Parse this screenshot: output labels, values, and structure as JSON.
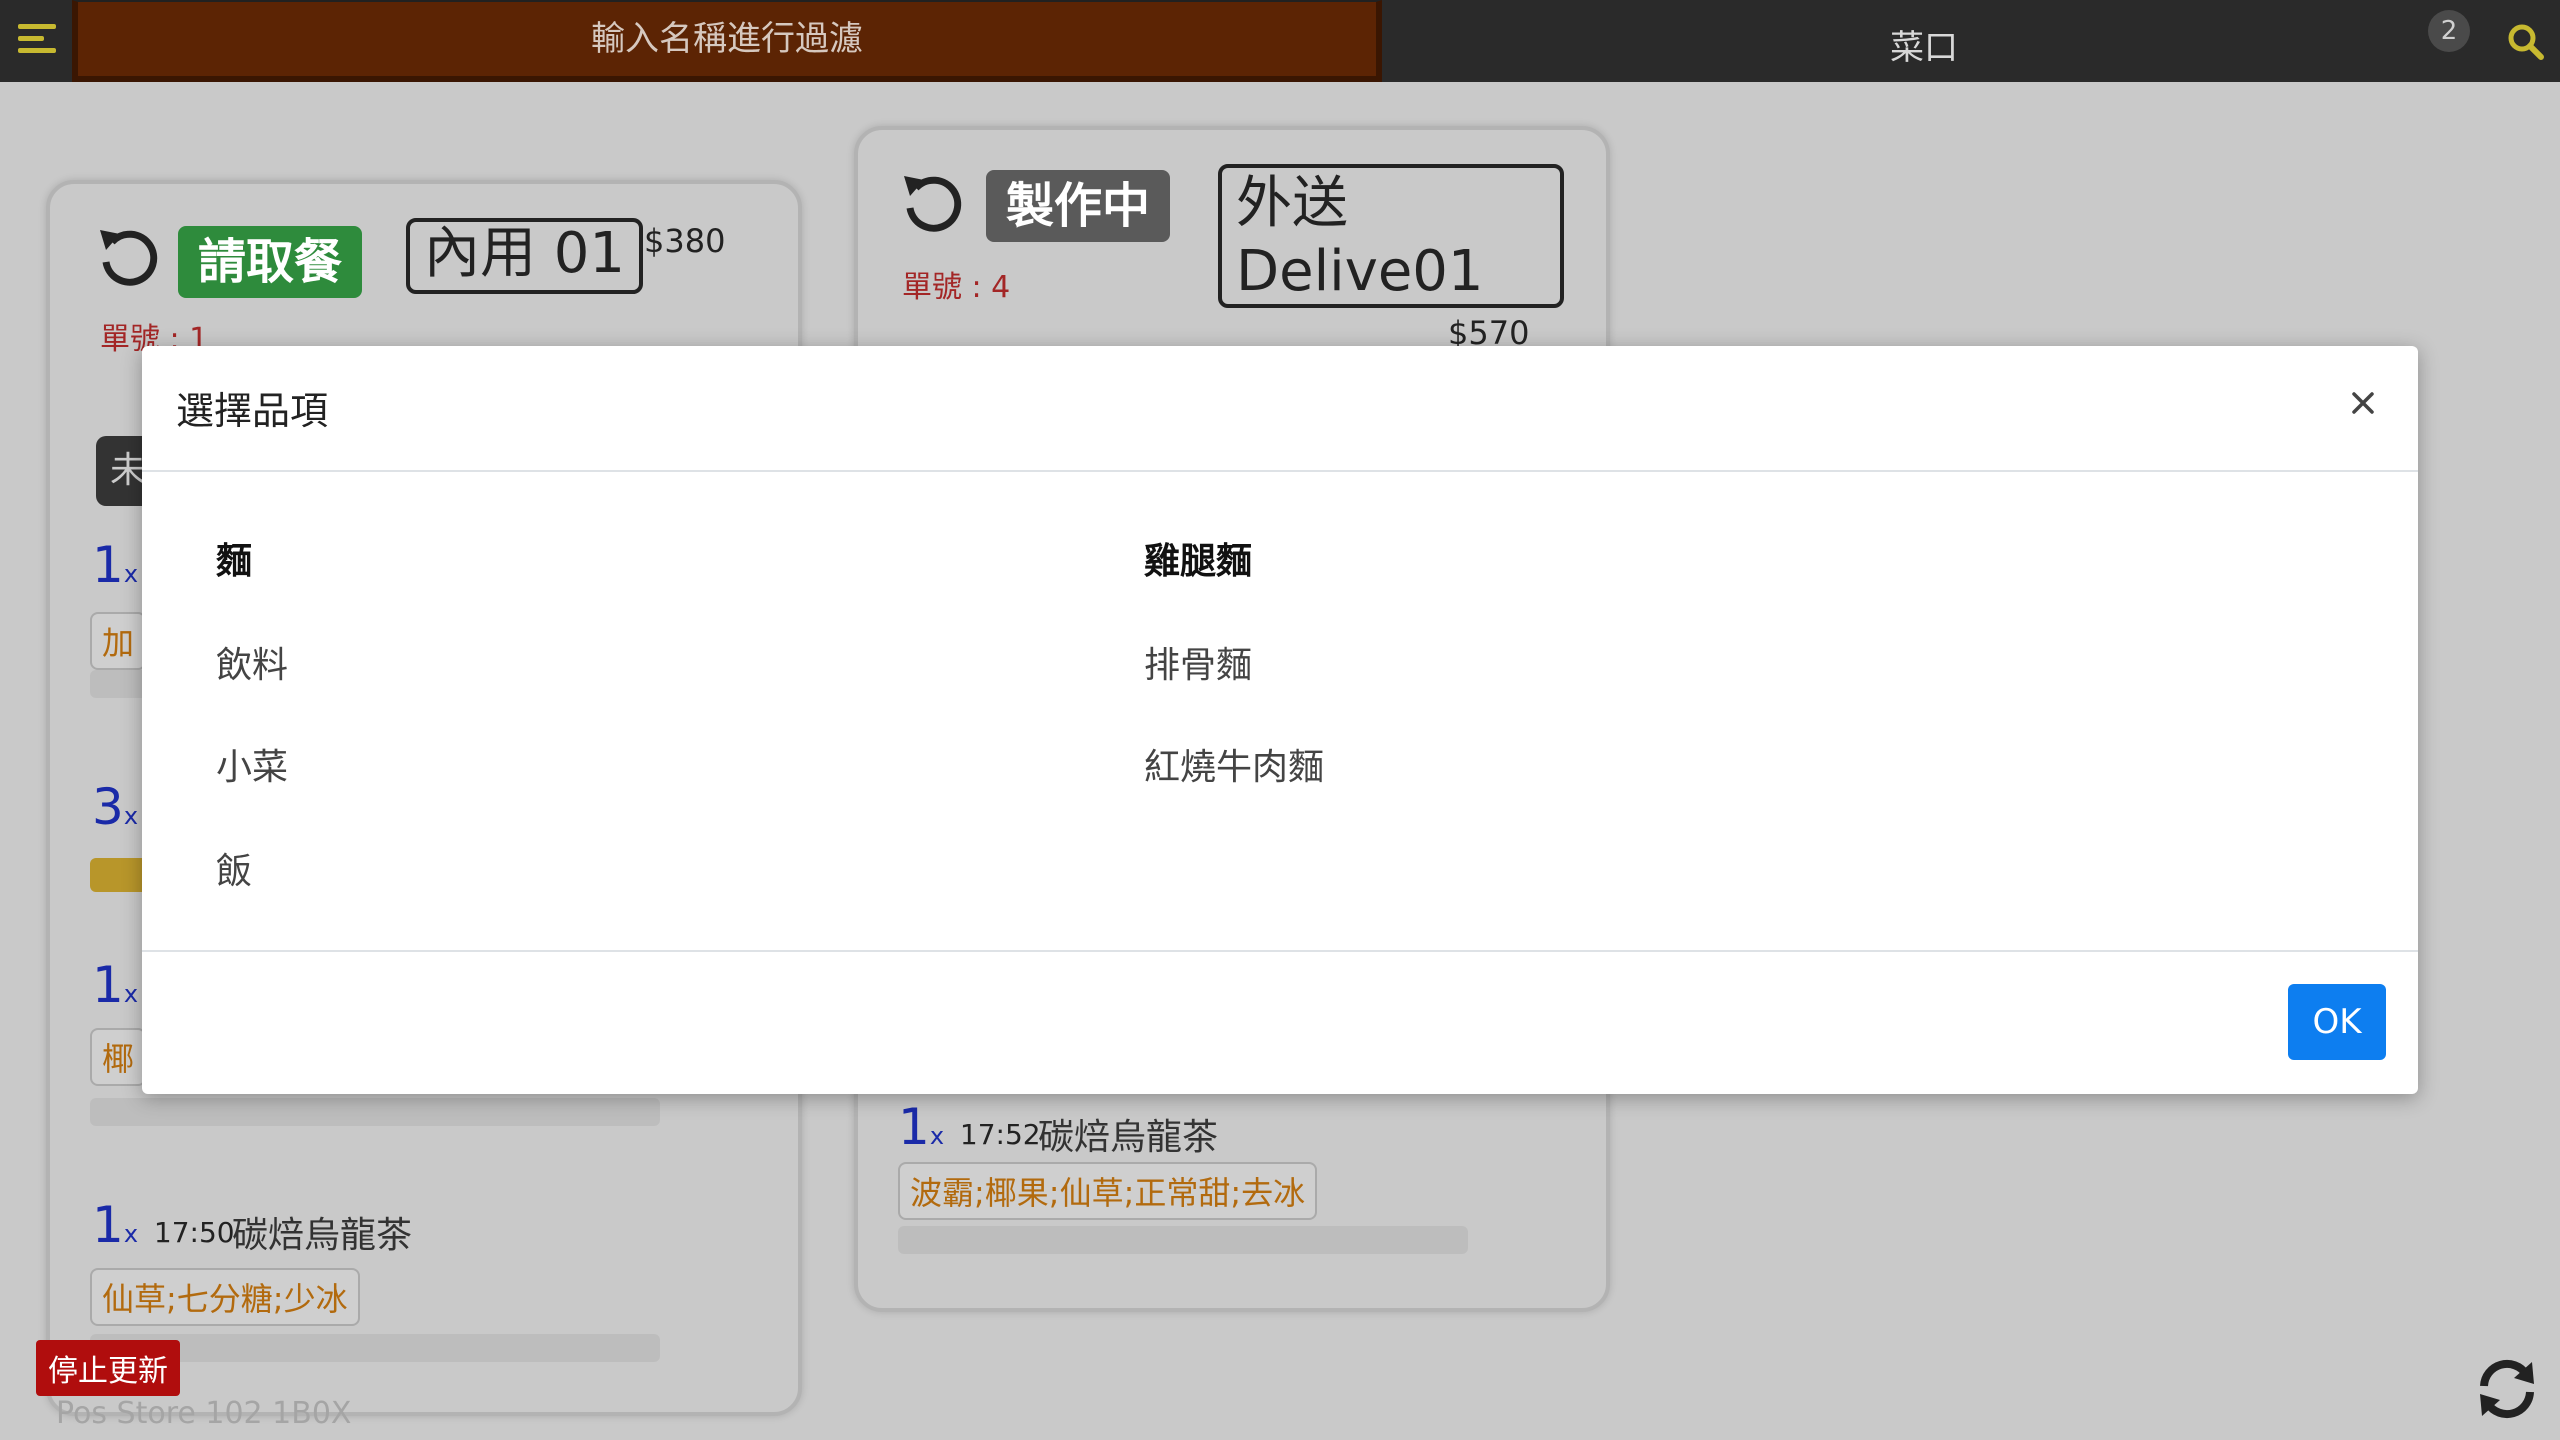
{
  "topbar": {
    "filter_placeholder": "輸入名稱進行過濾",
    "station_name": "菜口",
    "notification_count": "2"
  },
  "cards": [
    {
      "status": "請取餐",
      "table": "內用 01",
      "price": "$380",
      "order_no": "單號 : 1",
      "partial_button": "未",
      "items": [
        {
          "qty": "1",
          "unit": "x",
          "tag_fragment": "加"
        },
        {
          "qty": "3",
          "unit": "x"
        },
        {
          "qty": "1",
          "unit": "x",
          "tag_fragment": "椰"
        },
        {
          "qty": "1",
          "unit": "x",
          "time": "17:50",
          "name": "碳焙烏龍茶",
          "options": "仙草;七分糖;少冰"
        }
      ]
    },
    {
      "status": "製作中",
      "table": "外送\nDelive01",
      "table_line1": "外送",
      "table_line2": "Delive01",
      "price": "$570",
      "order_no": "單號 : 4",
      "items": [
        {
          "qty": "1",
          "unit": "x",
          "time": "17:52",
          "name": "碳焙烏龍茶",
          "options": "波霸;椰果;仙草;正常甜;去冰"
        }
      ]
    }
  ],
  "footer": {
    "stop_button": "停止更新",
    "store_text": "Pos Store 102 1B0X"
  },
  "modal": {
    "title": "選擇品項",
    "categories": [
      "麵",
      "飲料",
      "小菜",
      "飯"
    ],
    "items": [
      "雞腿麵",
      "排骨麵",
      "紅燒牛肉麵"
    ],
    "ok_label": "OK"
  },
  "colors": {
    "topbar_bg": "#2a2a2a",
    "filter_bg": "#5c2404",
    "accent_yellow": "#c7b930",
    "status_ready": "#2e8b3c",
    "status_cooking": "#5a5a5a",
    "order_no": "#a32626",
    "qty_blue": "#1a2aa8",
    "option_orange": "#b26a0e",
    "ok_blue": "#0d7ef0",
    "stop_red": "#b00d0d"
  }
}
